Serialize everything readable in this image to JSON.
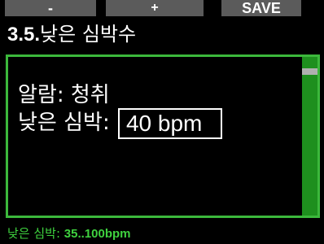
{
  "softkeys": {
    "minus": "-",
    "plus": "+",
    "save": "SAVE"
  },
  "title": {
    "number": "3.5.",
    "text": "낮은 심박수"
  },
  "content": {
    "alarm_label": "알람: ",
    "alarm_value": "청취",
    "low_hr_label": "낮은 심박: ",
    "low_hr_value": "40 bpm"
  },
  "footer": {
    "label": "낮은 심박: ",
    "range": "35..100bpm"
  },
  "colors": {
    "accent": "#3cb83c",
    "scrollbar": "#1e8f1e",
    "softkey_bg": "#5b5b5b"
  }
}
